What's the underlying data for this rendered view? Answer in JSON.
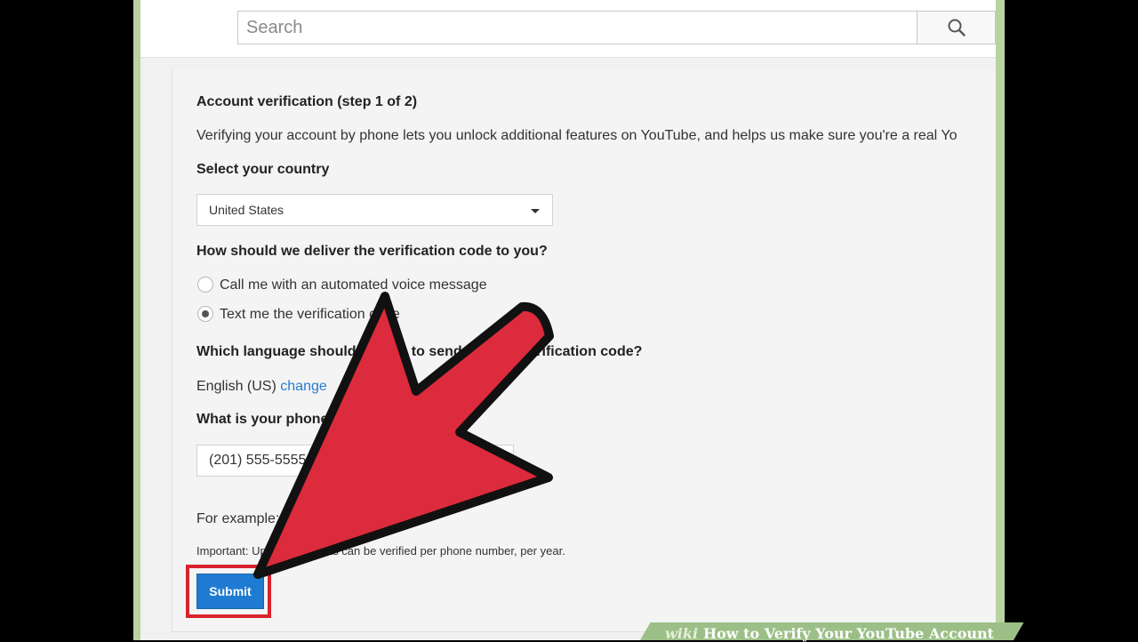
{
  "search": {
    "placeholder": "Search",
    "icon": "search-icon"
  },
  "form": {
    "title": "Account verification (step 1 of 2)",
    "intro": "Verifying your account by phone lets you unlock additional features on YouTube, and helps us make sure you're a real Yo",
    "country_label": "Select your country",
    "country_value": "United States",
    "delivery_label": "How should we deliver the verification code to you?",
    "delivery_options": [
      {
        "label": "Call me with an automated voice message",
        "checked": false
      },
      {
        "label": "Text me the verification code",
        "checked": true
      }
    ],
    "language_label": "Which language should we use to send you the verification code?",
    "language_value": "English (US)",
    "language_change": "change",
    "phone_label": "What is your phone number?",
    "phone_value": "(201) 555-5555",
    "example_text": "For example: (201) 555-5555",
    "important_text": "Important: Up to 2 accounts can be verified per phone number, per year.",
    "submit_label": "Submit"
  },
  "overlay": {
    "arrow_color": "#dc2b3c",
    "highlight_color": "#d9232e"
  },
  "banner": {
    "wiki": "wiki",
    "title": "How to Verify Your YouTube Account"
  }
}
